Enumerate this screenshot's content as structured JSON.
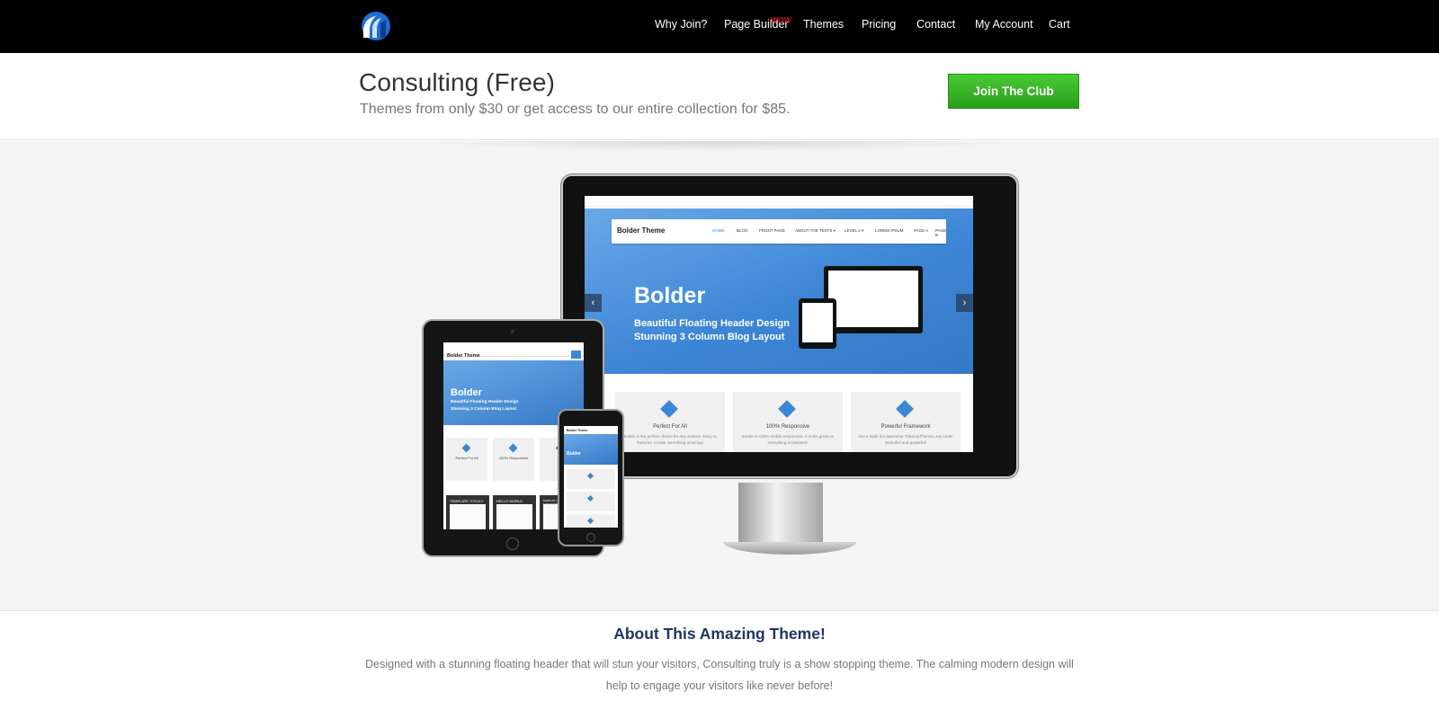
{
  "nav": {
    "items": [
      "Why Join?",
      "Page Builder",
      "Themes",
      "Pricing",
      "Contact",
      "My Account",
      "Cart"
    ],
    "badge": "WOW"
  },
  "header": {
    "title": "Consulting (Free)",
    "subtitle": "Themes from only $30 or get access to our entire collection for $85.",
    "cta_label": "Join The Club"
  },
  "preview": {
    "brand": "Bolder Theme",
    "menu": [
      "HOME",
      "BLOG",
      "FRONT PAGE",
      "ABOUT THE TESTS ▾",
      "LEVEL 1 ▾",
      "LOREM IPSUM",
      "PAGE A",
      "PAGE B"
    ],
    "hero_title": "Bolder",
    "hero_line1": "Beautiful Floating Header Design",
    "hero_line2": "Stunning 3 Column Blog Layout",
    "features": [
      {
        "title": "Perfect For All",
        "text": "Bolder is the perfect choice for any website. Easy to features. Create something amazing!"
      },
      {
        "title": "100% Responsive",
        "text": "Bolder is 100% mobile responsive. It looks great on everything in between!"
      },
      {
        "title": "Powerful Framework",
        "text": "Get a taste the awesome ThinkUpThemes any code! Beautiful and powerful!"
      }
    ],
    "tablet_posts": [
      "TEMPLATE: STICKY",
      "HELLO WORLD",
      "MARKUP: HTML TAGS AND FORMATTING"
    ]
  },
  "about": {
    "title": "About This Amazing Theme!",
    "text": "Designed with a stunning floating header that will stun your visitors, Consulting truly is a show stopping theme. The calming modern design will help to engage your visitors like never before!"
  },
  "colors": {
    "accent": "#3d86d6",
    "cta": "#2fae22",
    "badge": "#e0141e"
  }
}
